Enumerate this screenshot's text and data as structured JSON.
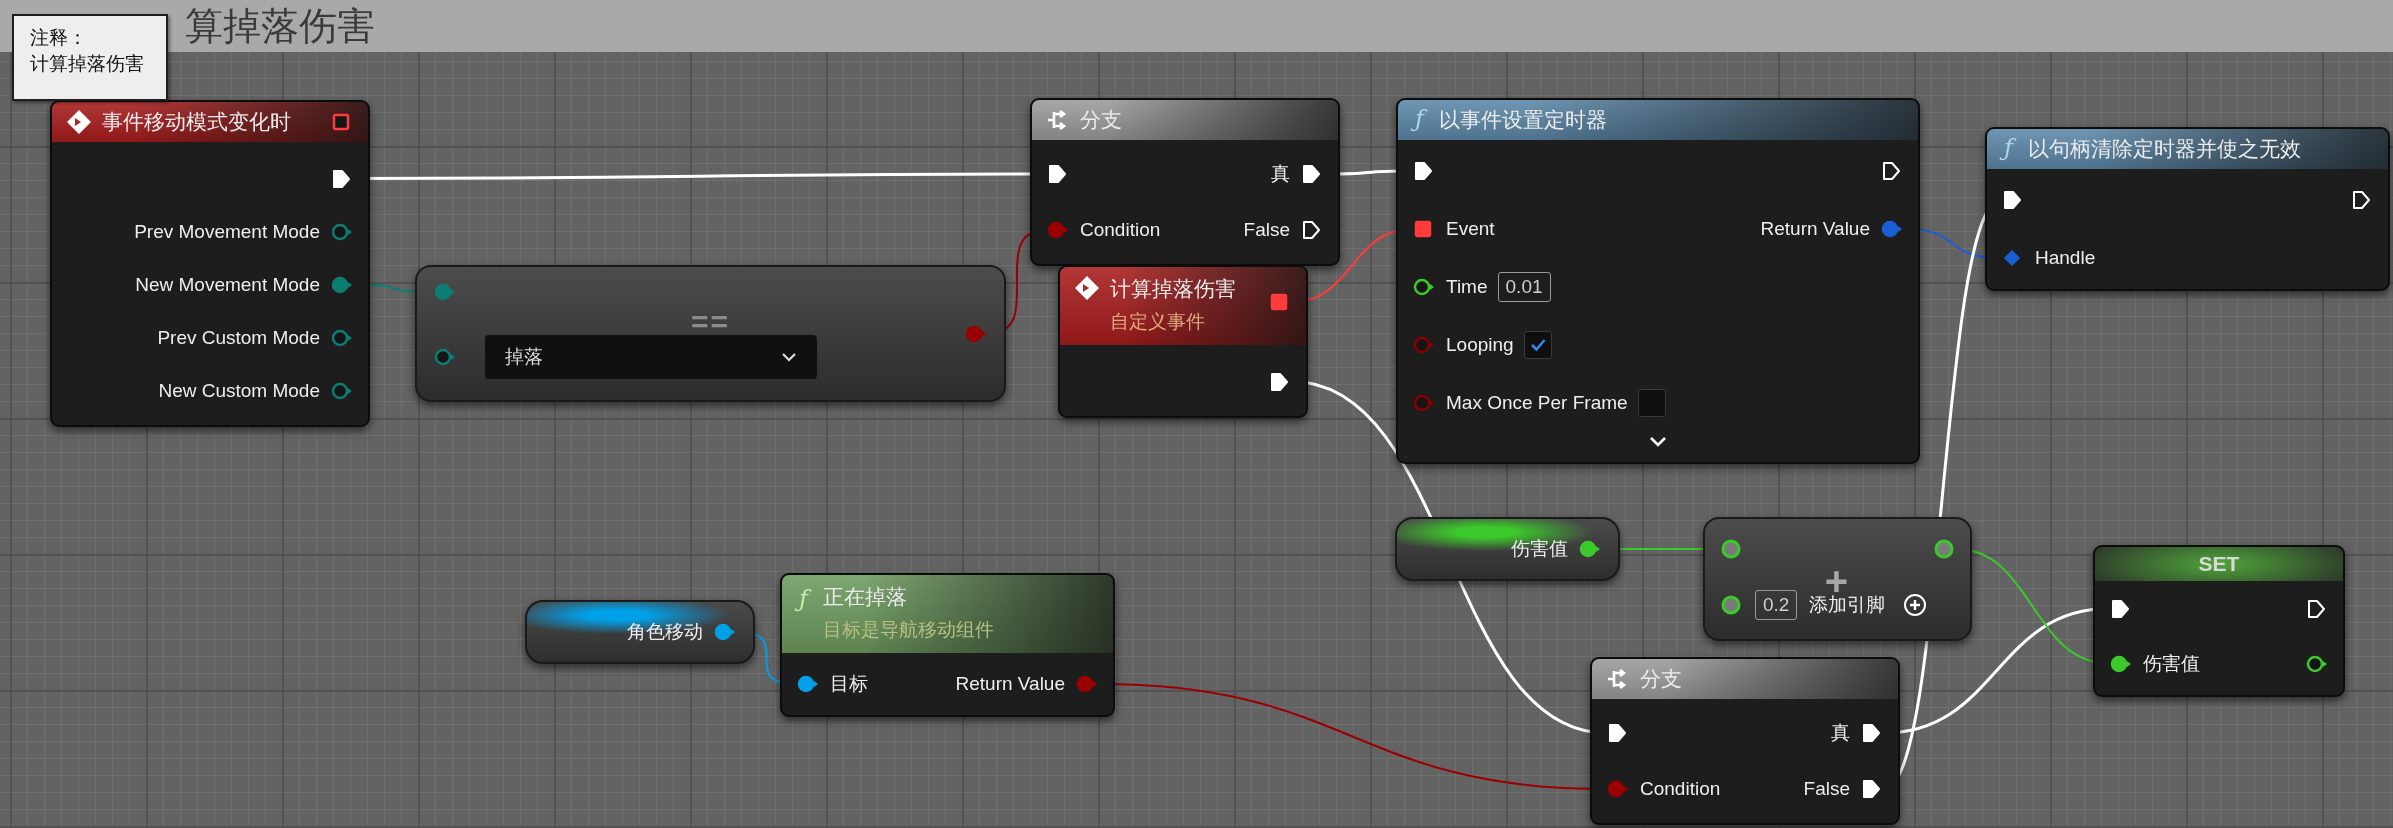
{
  "comment": {
    "title": "算掉落伤害"
  },
  "tooltip": {
    "label": "注释：",
    "text": "计算掉落伤害"
  },
  "nodes": [
    {
      "kind": "event",
      "title": "事件移动模式变化时",
      "color": "#a81c1c",
      "delegate": {
        "kind": "square",
        "color": "#ff3b3b",
        "connected": false
      },
      "rows": [
        {
          "right": {
            "kind": "exec",
            "connected": true
          }
        },
        {
          "right": {
            "kind": "circle",
            "label": "Prev Movement Mode",
            "color": "#0c7d72",
            "connected": false
          }
        },
        {
          "right": {
            "kind": "circle",
            "label": "New Movement Mode",
            "color": "#0c7d72",
            "connected": true
          }
        },
        {
          "right": {
            "kind": "circle",
            "label": "Prev Custom Mode",
            "color": "#0c7d72",
            "connected": false
          }
        },
        {
          "right": {
            "kind": "circle",
            "label": "New Custom Mode",
            "color": "#0c7d72",
            "connected": false
          }
        }
      ]
    },
    {
      "kind": "compare",
      "title": "==",
      "output": {
        "kind": "circle",
        "color": "#9b0000",
        "connected": true
      },
      "rows": [
        {
          "left": {
            "kind": "circle",
            "color": "#0c7d72",
            "connected": true
          }
        },
        {
          "left": {
            "kind": "circle",
            "color": "#0c7d72",
            "connected": false,
            "dropdown": "掉落"
          }
        }
      ]
    },
    {
      "kind": "branch",
      "title": "分支",
      "color": "#9a9a9a",
      "rows": [
        {
          "left": {
            "kind": "exec",
            "connected": true
          },
          "right": {
            "kind": "exec",
            "label": "真",
            "connected": true
          }
        },
        {
          "left": {
            "kind": "circle",
            "label": "Condition",
            "color": "#9b0000",
            "connected": true
          },
          "right": {
            "kind": "exec",
            "label": "False",
            "connected": false
          }
        }
      ]
    },
    {
      "kind": "event",
      "title": "计算掉落伤害",
      "subtitle": "自定义事件",
      "color": "#a81c1c",
      "delegate": {
        "kind": "square",
        "color": "#ff3b3b",
        "connected": true
      },
      "rows": [
        {
          "right": {
            "kind": "exec",
            "connected": true
          }
        }
      ]
    },
    {
      "kind": "function",
      "glyph": "ƒ",
      "title": "以事件设置定时器",
      "color": "#5b87a8",
      "expandable": true,
      "rows": [
        {
          "left": {
            "kind": "exec",
            "connected": true
          },
          "right": {
            "kind": "exec",
            "connected": false
          }
        },
        {
          "left": {
            "kind": "square",
            "label": "Event",
            "color": "#ff3b3b",
            "connected": true
          },
          "right": {
            "kind": "circle",
            "label": "Return Value",
            "color": "#1b5fd6",
            "connected": true
          }
        },
        {
          "left": {
            "kind": "circle",
            "label": "Time",
            "color": "#3cc92b",
            "connected": false,
            "value": "0.01"
          }
        },
        {
          "left": {
            "kind": "circle",
            "label": "Looping",
            "color": "#8a0000",
            "connected": false,
            "checked": true
          }
        },
        {
          "left": {
            "kind": "circle",
            "label": "Max Once Per Frame",
            "color": "#8a0000",
            "connected": false,
            "checked": false
          }
        }
      ]
    },
    {
      "kind": "function",
      "glyph": "ƒ",
      "title": "以句柄清除定时器并使之无效",
      "color": "#5b87a8",
      "rows": [
        {
          "left": {
            "kind": "exec",
            "connected": true
          },
          "right": {
            "kind": "exec",
            "connected": false
          }
        },
        {
          "left": {
            "kind": "diamond",
            "label": "Handle",
            "color": "#1b5fd6",
            "connected": true
          }
        }
      ]
    },
    {
      "kind": "getter",
      "color": "#3cc92b",
      "rows": [
        {
          "right": {
            "kind": "circle",
            "label": "伤害值",
            "color": "#3cc92b",
            "connected": true
          }
        }
      ]
    },
    {
      "kind": "add",
      "title": "+",
      "rows": [
        {
          "left": {
            "kind": "ring",
            "color": "#3cc92b"
          },
          "right": {
            "kind": "ring",
            "color": "#3cc92b"
          }
        },
        {
          "left": {
            "kind": "ring",
            "color": "#3cc92b",
            "value": "0.2",
            "add_pin": "添加引脚"
          }
        }
      ]
    },
    {
      "kind": "set",
      "title": "SET",
      "color": "#4fa53a",
      "rows": [
        {
          "left": {
            "kind": "exec",
            "connected": true
          },
          "right": {
            "kind": "exec",
            "connected": false
          }
        },
        {
          "left": {
            "kind": "circle",
            "label": "伤害值",
            "color": "#3cc92b",
            "connected": true
          },
          "right": {
            "kind": "circle",
            "color": "#3cc92b",
            "connected": false
          }
        }
      ]
    },
    {
      "kind": "branch",
      "title": "分支",
      "color": "#9a9a9a",
      "rows": [
        {
          "left": {
            "kind": "exec",
            "connected": true
          },
          "right": {
            "kind": "exec",
            "label": "真",
            "connected": true
          }
        },
        {
          "left": {
            "kind": "circle",
            "label": "Condition",
            "color": "#9b0000",
            "connected": true
          },
          "right": {
            "kind": "exec",
            "label": "False",
            "connected": true
          }
        }
      ]
    },
    {
      "kind": "getter",
      "color": "#00a0e8",
      "rows": [
        {
          "right": {
            "kind": "circle",
            "label": "角色移动",
            "color": "#00a0e8",
            "connected": true
          }
        }
      ]
    },
    {
      "kind": "function",
      "glyph": "ƒ",
      "title": "正在掉落",
      "subtitle": "目标是导航移动组件",
      "color": "#6c9a5e",
      "rows": [
        {
          "left": {
            "kind": "circle",
            "label": "目标",
            "color": "#00a0e8",
            "connected": true
          },
          "right": {
            "kind": "circle",
            "label": "Return Value",
            "color": "#9b0000",
            "connected": true
          }
        }
      ]
    }
  ]
}
